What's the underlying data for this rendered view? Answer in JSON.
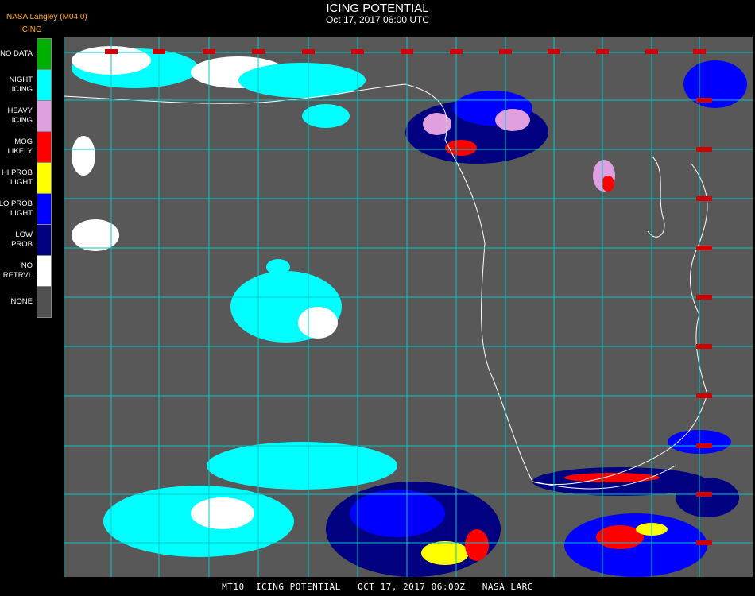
{
  "header": {
    "source": "NASA Langley (M04.0)",
    "title": "ICING POTENTIAL",
    "timestamp": "Oct 17, 2017 06:00 UTC"
  },
  "legend": {
    "title": "ICING",
    "items": [
      {
        "lines": [
          "NO DATA"
        ],
        "color": "#00b000"
      },
      {
        "lines": [
          "NIGHT",
          "ICING"
        ],
        "color": "#00ffff"
      },
      {
        "lines": [
          "HEAVY",
          "ICING"
        ],
        "color": "#e0a0e0"
      },
      {
        "lines": [
          "MOG",
          "LIKELY"
        ],
        "color": "#ff0000"
      },
      {
        "lines": [
          "HI PROB",
          "LIGHT"
        ],
        "color": "#ffff00"
      },
      {
        "lines": [
          "LO PROB",
          "LIGHT"
        ],
        "color": "#0000ff"
      },
      {
        "lines": [
          "LOW",
          "PROB"
        ],
        "color": "#000080"
      },
      {
        "lines": [
          "NO",
          "RETRVL"
        ],
        "color": "#ffffff"
      },
      {
        "lines": [
          "NONE"
        ],
        "color": "#505050"
      }
    ]
  },
  "map": {
    "background_color": "#585858",
    "grid_color": "#00c8c8",
    "border_color": "#ffffff",
    "label_color": "#d00000"
  },
  "footer": {
    "text": "MT10  ICING POTENTIAL   OCT 17, 2017 06:00Z   NASA LARC"
  }
}
